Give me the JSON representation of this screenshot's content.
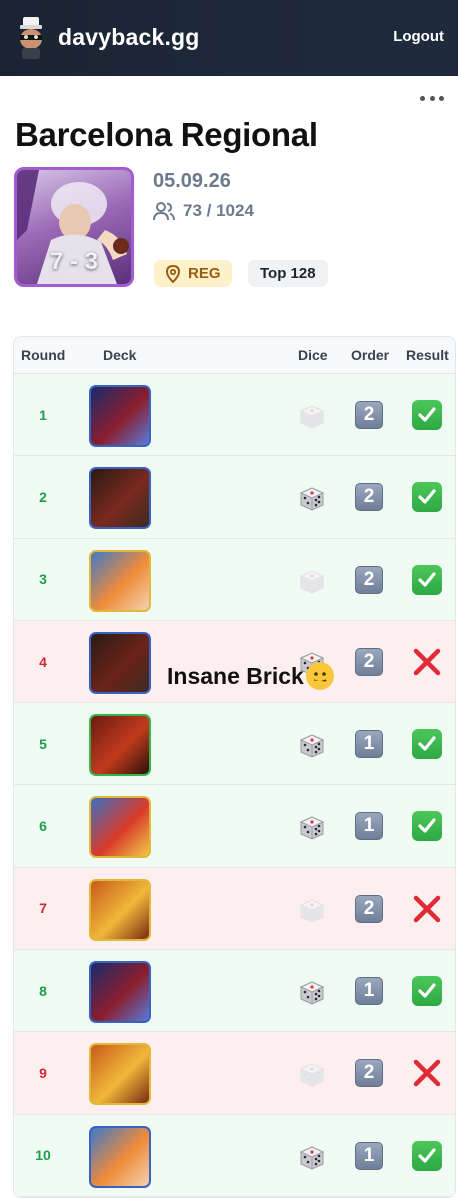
{
  "header": {
    "brand": "davyback.gg",
    "logout_label": "Logout"
  },
  "event": {
    "title": "Barcelona Regional",
    "date": "05.09.26",
    "players": "73 / 1024",
    "record": "7 - 3",
    "tag_reg": "REG",
    "tag_top": "Top 128"
  },
  "table": {
    "headers": {
      "round": "Round",
      "deck": "Deck",
      "dice": "Dice",
      "order": "Order",
      "result": "Result"
    },
    "rows": [
      {
        "round": "1",
        "deck_border": "#3a62c4",
        "deck_colors": [
          "#1b2a6b",
          "#8b1e2e",
          "#5a7ad8"
        ],
        "dice": "faded",
        "order": "2",
        "result": "win"
      },
      {
        "round": "2",
        "deck_border": "#3a62c4",
        "deck_colors": [
          "#2a1a14",
          "#7a2a1e",
          "#3d2a22"
        ],
        "dice": "dark",
        "order": "2",
        "result": "win"
      },
      {
        "round": "3",
        "deck_border": "#e0b83a",
        "deck_colors": [
          "#3e7ac8",
          "#f08b3a",
          "#f3d2b0"
        ],
        "dice": "faded",
        "order": "2",
        "result": "win"
      },
      {
        "round": "4",
        "deck_border": "#3a62c4",
        "deck_colors": [
          "#2a1a14",
          "#6b2418",
          "#3d2a22"
        ],
        "dice": "dark",
        "order": "2",
        "result": "loss"
      },
      {
        "round": "5",
        "deck_border": "#3ab24a",
        "deck_colors": [
          "#6b1a12",
          "#c23a1c",
          "#2a120c"
        ],
        "dice": "dark",
        "order": "1",
        "result": "win"
      },
      {
        "round": "6",
        "deck_border": "#e0b83a",
        "deck_colors": [
          "#3a6fc0",
          "#d83a2a",
          "#f0c84a"
        ],
        "dice": "dark",
        "order": "1",
        "result": "win"
      },
      {
        "round": "7",
        "deck_border": "#e0b83a",
        "deck_colors": [
          "#c85a1a",
          "#f0b83a",
          "#7a2a12"
        ],
        "dice": "faded",
        "order": "2",
        "result": "loss"
      },
      {
        "round": "8",
        "deck_border": "#3a62c4",
        "deck_colors": [
          "#1b2a6b",
          "#8b1e2e",
          "#5a7ad8"
        ],
        "dice": "dark",
        "order": "1",
        "result": "win"
      },
      {
        "round": "9",
        "deck_border": "#e0b83a",
        "deck_colors": [
          "#c85a1a",
          "#f0b83a",
          "#7a2a12"
        ],
        "dice": "faded",
        "order": "2",
        "result": "loss"
      },
      {
        "round": "10",
        "deck_border": "#3a62c4",
        "deck_colors": [
          "#3e7ac8",
          "#f08b3a",
          "#f3d2b0"
        ],
        "dice": "dark",
        "order": "1",
        "result": "win"
      }
    ]
  },
  "annotation": {
    "text": "Insane Brick",
    "emoji": "melting-face-icon"
  },
  "colors": {
    "win_text": "#1e9d4a",
    "loss_text": "#d22835",
    "win_bg": "#f0fbf3",
    "loss_bg": "#fdeff0",
    "header_bg": "#1b2433"
  }
}
